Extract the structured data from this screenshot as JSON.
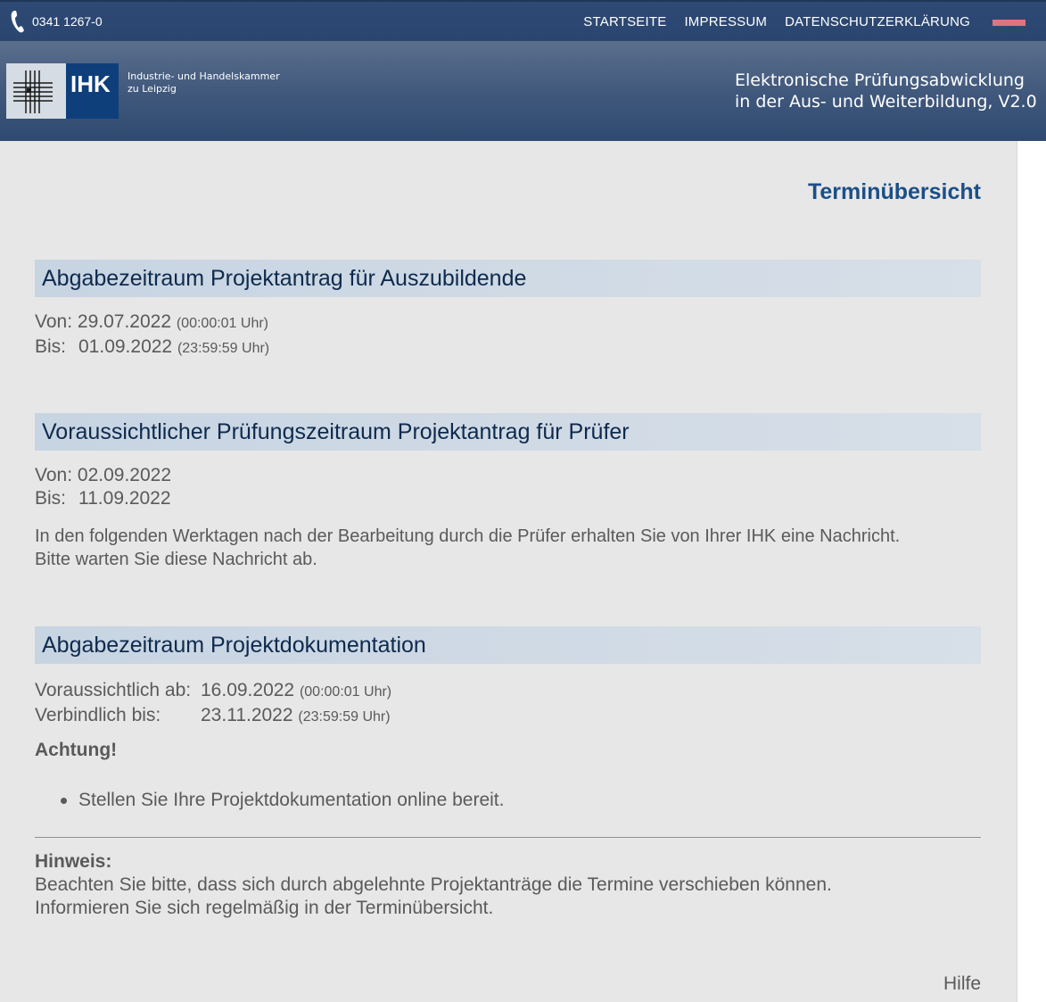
{
  "topbar": {
    "phone": "0341 1267-0",
    "nav": [
      "STARTSEITE",
      "IMPRESSUM",
      "DATENSCHUTZERKLÄRUNG"
    ],
    "flag_color": "#e2727e"
  },
  "header": {
    "logo_mark": "IHK",
    "logo_line1": "Industrie- und Handelskammer",
    "logo_line2": "zu Leipzig",
    "app_title_line1": "Elektronische Prüfungsabwicklung",
    "app_title_line2": "in der Aus- und Weiterbildung, V2.0"
  },
  "main": {
    "page_title": "Terminübersicht",
    "section1": {
      "heading": "Abgabezeitraum Projektantrag für Auszubildende",
      "from_label": "Von:",
      "from_date": "29.07.2022",
      "from_time": "(00:00:01 Uhr)",
      "to_label": "Bis:",
      "to_date": "01.09.2022",
      "to_time": "(23:59:59 Uhr)"
    },
    "section2": {
      "heading": "Voraussichtlicher Prüfungszeitraum Projektantrag für Prüfer",
      "from_label": "Von:",
      "from_date": "02.09.2022",
      "to_label": "Bis:",
      "to_date": "11.09.2022",
      "note_line1": "In den folgenden Werktagen nach der Bearbeitung durch die Prüfer erhalten Sie von Ihrer IHK eine Nachricht.",
      "note_line2": "Bitte warten Sie diese Nachricht ab."
    },
    "section3": {
      "heading": "Abgabezeitraum Projektdokumentation",
      "from_label": "Voraussichtlich ab:",
      "from_date": "16.09.2022",
      "from_time": "(00:00:01 Uhr)",
      "to_label": "Verbindlich bis:",
      "to_date": "23.11.2022",
      "to_time": "(23:59:59 Uhr)",
      "warning": "Achtung!",
      "bullet": "Stellen Sie Ihre Projektdokumentation online bereit."
    },
    "hint": {
      "title": "Hinweis:",
      "line1": "Beachten Sie bitte, dass sich durch abgelehnte Projektanträge die Termine verschieben können.",
      "line2": "Informieren Sie sich regelmäßig in der Terminübersicht."
    },
    "help": "Hilfe"
  }
}
